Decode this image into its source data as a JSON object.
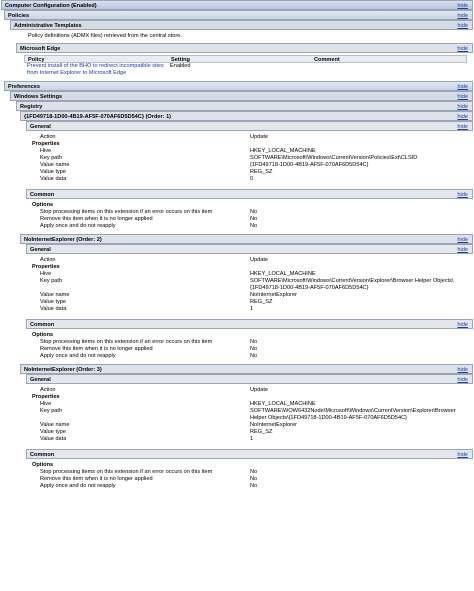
{
  "hide": "hide",
  "computer_config": "Computer Configuration (Enabled)",
  "policies": "Policies",
  "admin_templates": "Administrative Templates",
  "admx_note": "Policy definitions (ADMX files) retrieved from the central store.",
  "edge": "Microsoft Edge",
  "policy_table": {
    "headers": [
      "Policy",
      "Setting",
      "Comment"
    ],
    "row": {
      "policy_line1": "Prevent install of the BHO to redirect incompatible sites",
      "policy_line2": "from Internet Explorer to Microsoft Edge",
      "setting": "Enabled",
      "comment": ""
    }
  },
  "preferences": "Preferences",
  "windows_settings": "Windows Settings",
  "registry": "Registry",
  "labels": {
    "general": "General",
    "common": "Common",
    "options": "Options",
    "properties": "Properties",
    "action": "Action",
    "hive": "Hive",
    "key_path": "Key path",
    "value_name": "Value name",
    "value_type": "Value type",
    "value_data": "Value data",
    "stop": "Stop processing items on this extension if an error occurs on this item",
    "remove": "Remove this item when it is no longer applied",
    "apply_once": "Apply once and do not reapply"
  },
  "entries": [
    {
      "title": "{1FD49718-1D00-4B19-AF5F-070AF6D5D54C} (Order: 1)",
      "action": "Update",
      "hive": "HKEY_LOCAL_MACHINE",
      "key_path": "SOFTWARE\\Microsoft\\Windows\\CurrentVersion\\Policies\\Ext\\CLSID",
      "value_name": "{1FD49718-1D00-4B19-AF5F-070AF6D5D54C}",
      "value_type": "REG_SZ",
      "value_data": "0",
      "stop": "No",
      "remove": "No",
      "apply_once": "No"
    },
    {
      "title": "NoInternetExplorer (Order: 2)",
      "action": "Update",
      "hive": "HKEY_LOCAL_MACHINE",
      "key_path": "SOFTWARE\\Microsoft\\Windows\\CurrentVersion\\Explorer\\Browser Helper Objects\\{1FD49718-1D00-4B19-AF5F-070AF6D5D54C}",
      "value_name": "NoInternetExplorer",
      "value_type": "REG_SZ",
      "value_data": "1",
      "stop": "No",
      "remove": "No",
      "apply_once": "No"
    },
    {
      "title": "NoInternetExplorer (Order: 3)",
      "action": "Update",
      "hive": "HKEY_LOCAL_MACHINE",
      "key_path": "SOFTWARE\\WOW6432Node\\Microsoft\\Windows\\CurrentVersion\\Explorer\\Browser Helper Objects\\{1FD49718-1D00-4B19-AF5F-070AF6D5D54C}",
      "value_name": "NoInternetExplorer",
      "value_type": "REG_SZ",
      "value_data": "1",
      "stop": "No",
      "remove": "No",
      "apply_once": "No"
    }
  ]
}
